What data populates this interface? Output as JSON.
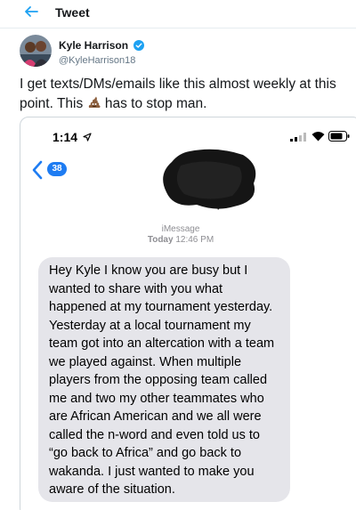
{
  "header": {
    "title": "Tweet",
    "back_icon": "back-arrow-icon"
  },
  "tweet": {
    "author_name": "Kyle Harrison",
    "author_handle": "@KyleHarrison18",
    "verified_icon": "verified-badge-icon",
    "text_before": "I get texts/DMs/emails like this almost weekly at this point. This ",
    "emoji": "pile-of-poo-emoji",
    "text_after": " has to stop man."
  },
  "screenshot": {
    "status_time": "1:14",
    "back_count": "38",
    "service_label": "iMessage",
    "timestamp_day": "Today",
    "timestamp_time": "12:46 PM",
    "message": "Hey Kyle I know you are busy but I wanted to share with you what happened at my tournament yesterday. Yesterday at a local tournament my team got into an altercation with a team we played against. When multiple players from the opposing team called me and two my other teammates who are African American and we all were called the n-word and even told us to “go back to Africa” and go back to wakanda. I just wanted to make you aware of the situation."
  },
  "colors": {
    "accent": "#1da1f2",
    "ios_blue": "#1e7cf2",
    "bubble": "#e5e5ea",
    "handle": "#657786"
  }
}
